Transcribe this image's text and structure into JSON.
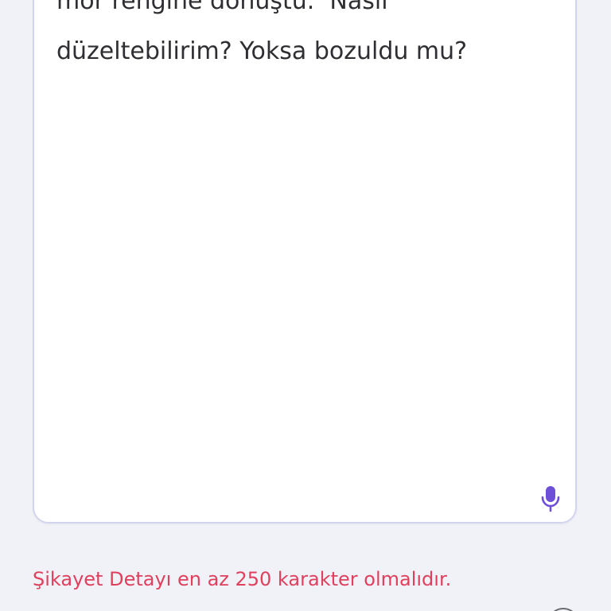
{
  "complaint": {
    "text": "mor rengine dönüştü.  Nasıl\ndüzeltebilirim? Yoksa bozuldu mu?"
  },
  "validation": {
    "error": "Şikayet Detayı en az 250 karakter olmalıdır."
  },
  "icons": {
    "voice_input": "microphone-icon",
    "partial_control": "circle-icon"
  },
  "colors": {
    "accent": "#6d4fd8",
    "error": "#e0405e",
    "field_border": "#d3d5ee",
    "background": "#f1f2f7"
  }
}
